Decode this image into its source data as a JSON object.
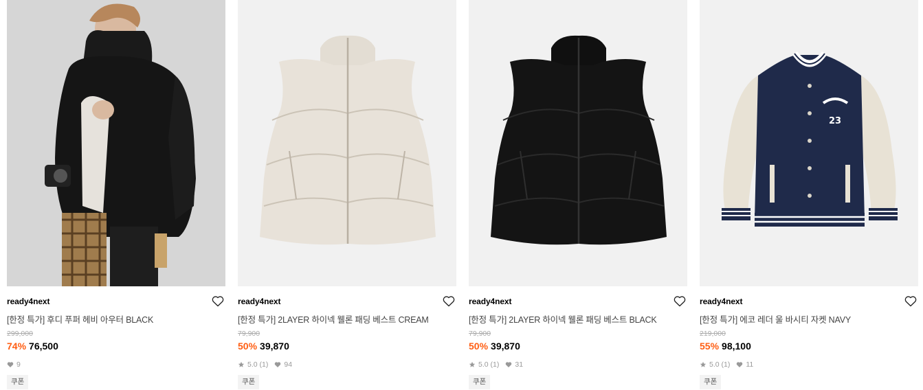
{
  "products": [
    {
      "brand": "ready4next",
      "title": "[한정 특가] 후디 푸퍼 헤비 아우터 BLACK",
      "original_price": "299,000",
      "discount": "74%",
      "price": "76,500",
      "likes": "9",
      "coupon": "쿠폰",
      "image": "model-black-hooded-puffer"
    },
    {
      "brand": "ready4next",
      "title": "[한정 특가] 2LAYER 하이넥 웰론 패딩 베스트 CREAM",
      "original_price": "79,900",
      "discount": "50%",
      "price": "39,870",
      "rating": "5.0 (1)",
      "likes": "94",
      "coupon": "쿠폰",
      "image": "cream-padded-vest"
    },
    {
      "brand": "ready4next",
      "title": "[한정 특가] 2LAYER 하이넥 웰론 패딩 베스트 BLACK",
      "original_price": "79,900",
      "discount": "50%",
      "price": "39,870",
      "rating": "5.0 (1)",
      "likes": "31",
      "coupon": "쿠폰",
      "image": "black-padded-vest"
    },
    {
      "brand": "ready4next",
      "title": "[한정 특가] 에코 레더 울 바시티 자켓 NAVY",
      "original_price": "219,000",
      "discount": "55%",
      "price": "98,100",
      "rating": "5.0 (1)",
      "likes": "11",
      "coupon": "쿠폰",
      "image": "navy-varsity-jacket",
      "patch_number": "23"
    }
  ],
  "colors": {
    "discount": "#ff5e13",
    "image_bg": "#f1f1f1",
    "cream": "#e8e2d9",
    "navy": "#1f2a4a"
  }
}
